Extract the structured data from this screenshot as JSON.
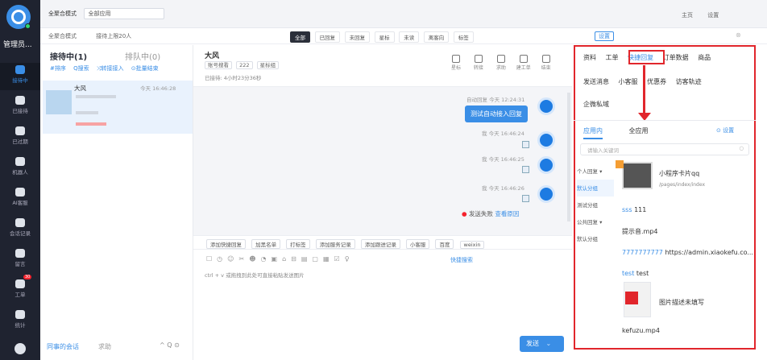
{
  "nav": {
    "user": "管理员...",
    "items": [
      {
        "label": "接待中",
        "icon": "chat-bubble-icon",
        "active": true
      },
      {
        "label": "已接待",
        "icon": "history-icon"
      },
      {
        "label": "已过期",
        "icon": "clock-icon"
      },
      {
        "label": "机器人",
        "icon": "robot-icon"
      },
      {
        "label": "AI客服",
        "icon": "ai-agent-icon"
      },
      {
        "label": "会话记录",
        "icon": "message-record-icon"
      },
      {
        "label": "留言",
        "icon": "note-icon"
      },
      {
        "label": "工单",
        "icon": "ticket-icon",
        "badge": "30"
      },
      {
        "label": "统计",
        "icon": "stats-icon"
      }
    ]
  },
  "topbar": {
    "mode_label": "全聚合模式",
    "mode_select": "全部应用",
    "home": "主页",
    "settings": "设置"
  },
  "bar2": {
    "mode": "全聚合模式",
    "limit": "接待上限20人",
    "tabs": [
      "全部",
      "已回复",
      "未回复",
      "星标",
      "未读",
      "离客向",
      "标签"
    ],
    "settings_btn": "设置",
    "close": "⊗"
  },
  "left_panel": {
    "receiving": "接待中(1)",
    "queue": "排队中(0)",
    "actions": [
      "#排序",
      "Q搜索",
      "⤨转接接入",
      "⊙批量结束"
    ],
    "conversation": {
      "name": "大风",
      "time": "今天 16:46:28"
    },
    "footer_colleagues": "同事的会话",
    "footer_help": "求助",
    "footer_icons": "^ Q ⊙"
  },
  "chat": {
    "customer": "大风",
    "tags": [
      "账号搜看",
      "222",
      "星标组"
    ],
    "status": "已接待: 4小时23分36秒",
    "header_icons": [
      {
        "label": "星标",
        "icon": "star-icon"
      },
      {
        "label": "转接",
        "icon": "transfer-icon"
      },
      {
        "label": "求助",
        "icon": "help-icon"
      },
      {
        "label": "建工单",
        "icon": "ticket-create-icon"
      },
      {
        "label": "结束",
        "icon": "power-icon"
      }
    ],
    "messages": [
      {
        "meta": "自动回复 今天 12:24:31",
        "text": "测试自动接入回复"
      },
      {
        "meta": "我 今天 16:46:24"
      },
      {
        "meta": "我 今天 16:46:25"
      },
      {
        "meta": "我 今天 16:46:26"
      }
    ],
    "fail_text": "发送失败",
    "fail_link": "查看原因",
    "toolbar": [
      "添加快捷回复",
      "加黑名单",
      "打标签",
      "添加服务记录",
      "添加跟进记录",
      "小客服",
      "百度",
      "weixin"
    ],
    "quick_search": "快捷搜索",
    "editor_hint": "ctrl + v 或拖拽到此处可直接粘贴发送图片",
    "send": "发送"
  },
  "right_panel": {
    "tabs_row1": [
      "资料",
      "工单",
      "快捷回复",
      "订单数据",
      "商品"
    ],
    "tabs_row2": [
      "发送消息",
      "小客服",
      "优惠券",
      "访客轨迹"
    ],
    "tabs_row3": [
      "企微私域"
    ],
    "sub_tabs": [
      "应用内",
      "全应用"
    ],
    "settings": "设置",
    "search_placeholder": "请输入关键词",
    "groups": [
      "个人回复 ▾",
      "默认分组",
      "测试分组",
      "公共回复 ▾",
      "默认分组"
    ],
    "card1_title": "小程序卡片qq",
    "card1_path": "/pages/index/index",
    "items": [
      {
        "key": "sss",
        "val": "111"
      },
      {
        "key": "",
        "val": "提示音.mp4"
      },
      {
        "key": "7777777777",
        "val": "https://admin.xiaokefu.co..."
      },
      {
        "key": "test",
        "val": "test"
      }
    ],
    "card2_title": "图片描述未填写",
    "last_item": "kefuzu.mp4"
  },
  "colors": {
    "accent": "#3a8ee6",
    "highlight": "#e1262c",
    "nav": "#1f2330"
  }
}
